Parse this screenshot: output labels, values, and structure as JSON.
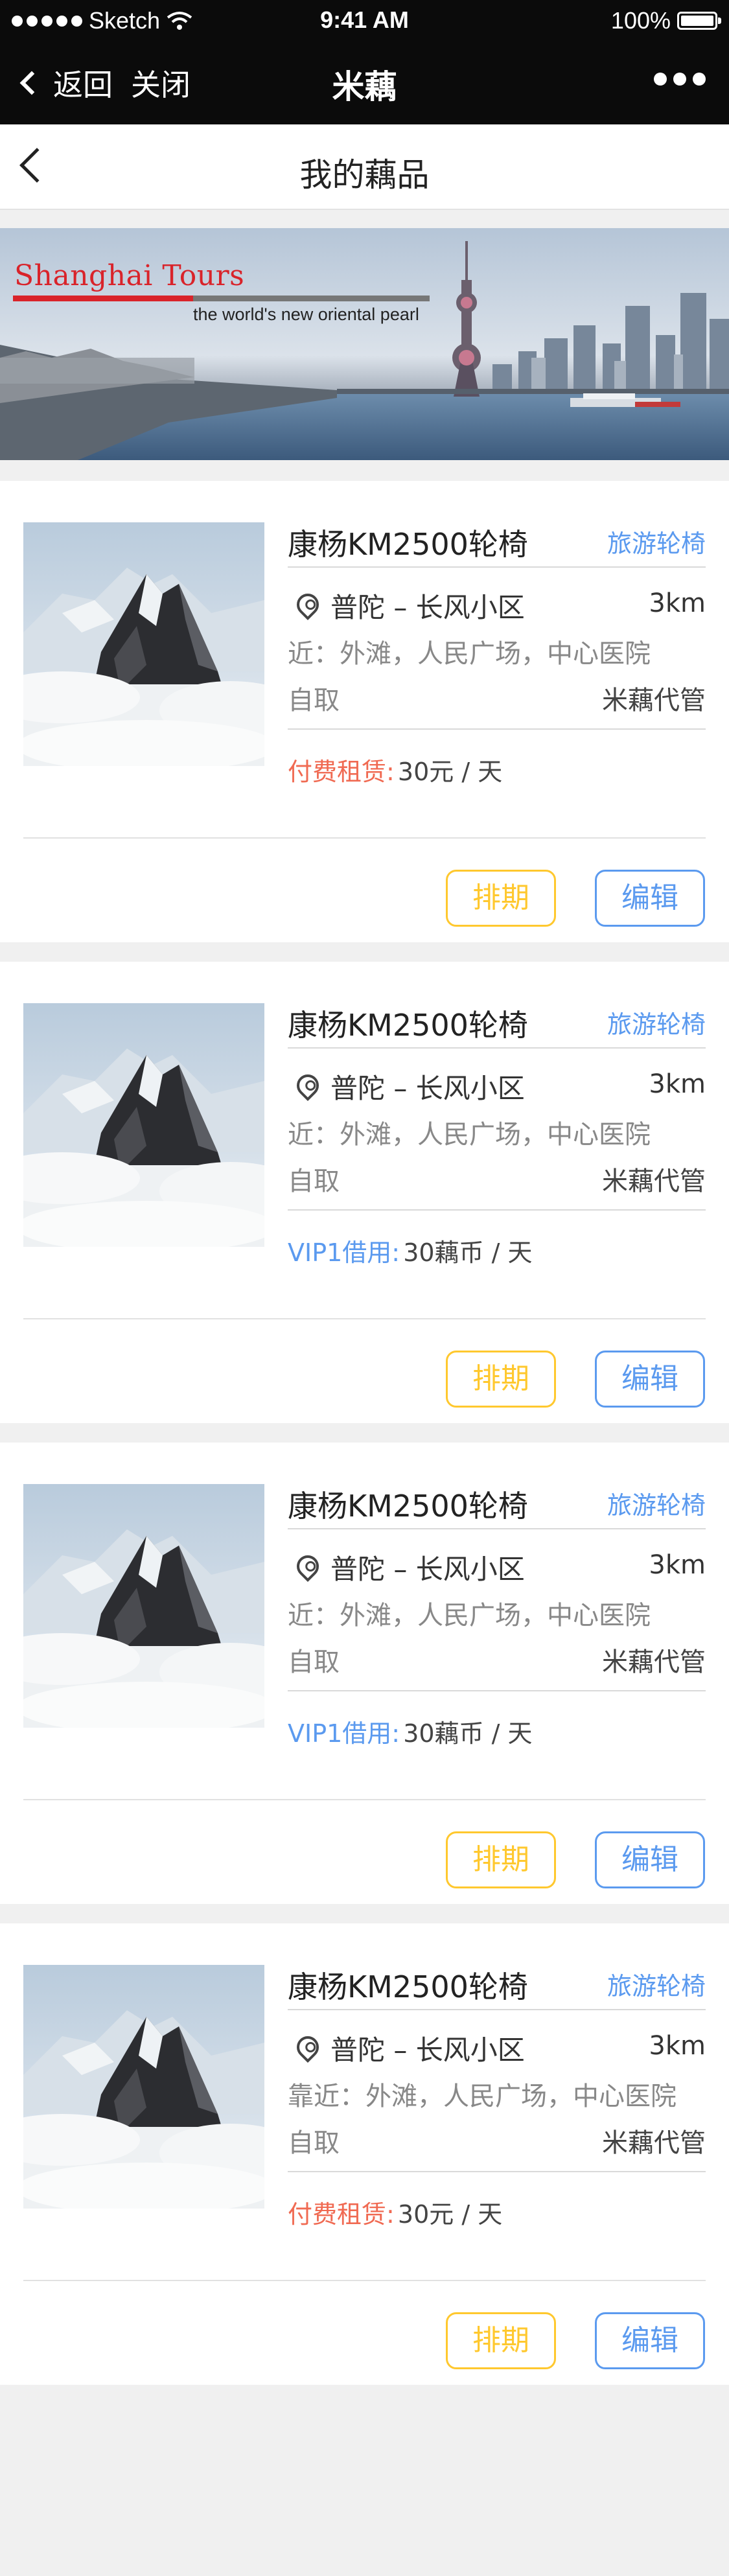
{
  "status_bar": {
    "carrier": "Sketch",
    "time": "9:41 AM",
    "battery": "100%"
  },
  "app_bar": {
    "back_label": "返回",
    "close_label": "关闭",
    "title": "米藕",
    "more_icon": "more-dots-icon"
  },
  "page": {
    "title": "我的藕品",
    "back_icon": "chevron-left-icon"
  },
  "banner": {
    "brand": "Shanghai Tours",
    "tagline": "the world's new oriental pearl"
  },
  "items": [
    {
      "name": "康杨KM2500轮椅",
      "category": "旅游轮椅",
      "location": "普陀 – 长风小区",
      "distance": "3km",
      "nearby": "近：外滩，人民广场，中心医院",
      "pickup": "自取",
      "custody": "米藕代管",
      "price_label": "付费租赁:",
      "price_value": "30元 / 天",
      "price_type": "paid",
      "schedule_label": "排期",
      "edit_label": "编辑"
    },
    {
      "name": "康杨KM2500轮椅",
      "category": "旅游轮椅",
      "location": "普陀 – 长风小区",
      "distance": "3km",
      "nearby": "近：外滩，人民广场，中心医院",
      "pickup": "自取",
      "custody": "米藕代管",
      "price_label": "VIP1借用:",
      "price_value": "30藕币 / 天",
      "price_type": "vip",
      "schedule_label": "排期",
      "edit_label": "编辑"
    },
    {
      "name": "康杨KM2500轮椅",
      "category": "旅游轮椅",
      "location": "普陀 – 长风小区",
      "distance": "3km",
      "nearby": "近：外滩，人民广场，中心医院",
      "pickup": "自取",
      "custody": "米藕代管",
      "price_label": "VIP1借用:",
      "price_value": "30藕币 / 天",
      "price_type": "vip",
      "schedule_label": "排期",
      "edit_label": "编辑"
    },
    {
      "name": "康杨KM2500轮椅",
      "category": "旅游轮椅",
      "location": "普陀 – 长风小区",
      "distance": "3km",
      "nearby": "靠近：外滩，人民广场，中心医院",
      "pickup": "自取",
      "custody": "米藕代管",
      "price_label": "付费租赁:",
      "price_value": "30元 / 天",
      "price_type": "paid",
      "schedule_label": "排期",
      "edit_label": "编辑"
    }
  ],
  "colors": {
    "accent_blue": "#5b9aef",
    "accent_yellow": "#ffc82e",
    "price_red": "#f06a52",
    "top_bar": "#0b0b0b",
    "background": "#f0f0f0"
  }
}
